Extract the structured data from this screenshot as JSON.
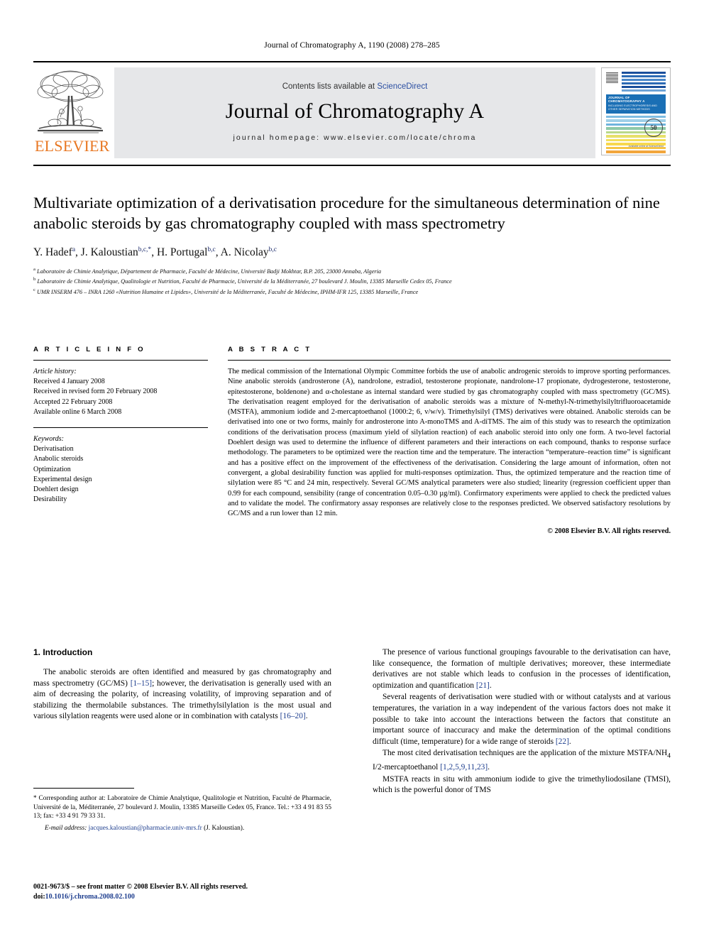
{
  "running_head": "Journal of Chromatography A, 1190 (2008) 278–285",
  "masthead": {
    "contents_prefix": "Contents lists available at ",
    "sciencedirect": "ScienceDirect",
    "journal_name": "Journal of Chromatography A",
    "homepage": "journal homepage: www.elsevier.com/locate/chroma",
    "publisher_logo_text": "ELSEVIER",
    "cover": {
      "title": "JOURNAL OF CHROMATOGRAPHY A",
      "subtitle": "INCLUDING ELECTROPHORESIS AND OTHER SEPARATION METHODS",
      "badge": "50",
      "badge_sub": "YEARS",
      "foot": "Available online at\nScienceDirect"
    }
  },
  "article": {
    "title": "Multivariate optimization of a derivatisation procedure for the simultaneous determination of nine anabolic steroids by gas chromatography coupled with mass spectrometry",
    "authors": [
      {
        "name": "Y. Hadef",
        "sup": "a"
      },
      {
        "name": "J. Kaloustian",
        "sup": "b,c,*"
      },
      {
        "name": "H. Portugal",
        "sup": "b,c"
      },
      {
        "name": "A. Nicolay",
        "sup": "b,c"
      }
    ],
    "affiliations": [
      {
        "mark": "a",
        "text": "Laboratoire de Chimie Analytique, Département de Pharmacie, Faculté de Médecine, Université Badji Mokhtar, B.P. 205, 23000 Annaba, Algeria"
      },
      {
        "mark": "b",
        "text": "Laboratoire de Chimie Analytique, Qualitologie et Nutrition, Faculté de Pharmacie, Université de la Méditerranée, 27 boulevard J. Moulin, 13385 Marseille Cedex 05, France"
      },
      {
        "mark": "c",
        "text": "UMR INSERM 476 – INRA 1260 «Nutrition Humaine et Lipides», Université de la Méditerranée, Faculté de Médecine, IPHM-IFR 125, 13385 Marseille, France"
      }
    ]
  },
  "info": {
    "heading": "A R T I C L E   I N F O",
    "history_label": "Article history:",
    "history": [
      "Received 4 January 2008",
      "Received in revised form 20 February 2008",
      "Accepted 22 February 2008",
      "Available online 6 March 2008"
    ],
    "keywords_label": "Keywords:",
    "keywords": [
      "Derivatisation",
      "Anabolic steroids",
      "Optimization",
      "Experimental design",
      "Doehlert design",
      "Desirability"
    ]
  },
  "abstract": {
    "heading": "A B S T R A C T",
    "text": "The medical commission of the International Olympic Committee forbids the use of anabolic androgenic steroids to improve sporting performances. Nine anabolic steroids (androsterone (A), nandrolone, estradiol, testosterone propionate, nandrolone-17 propionate, dydrogesterone, testosterone, epitestosterone, boldenone) and α-cholestane as internal standard were studied by gas chromatography coupled with mass spectrometry (GC/MS). The derivatisation reagent employed for the derivatisation of anabolic steroids was a mixture of N-methyl-N-trimethylsilyltrifluoroacetamide (MSTFA), ammonium iodide and 2-mercaptoethanol (1000:2; 6, v/w/v). Trimethylsilyl (TMS) derivatives were obtained. Anabolic steroids can be derivatised into one or two forms, mainly for androsterone into A-monoTMS and A-diTMS. The aim of this study was to research the optimization conditions of the derivatisation process (maximum yield of silylation reaction) of each anabolic steroid into only one form. A two-level factorial Doehlert design was used to determine the influence of different parameters and their interactions on each compound, thanks to response surface methodology. The parameters to be optimized were the reaction time and the temperature. The interaction “temperature–reaction time” is significant and has a positive effect on the improvement of the effectiveness of the derivatisation. Considering the large amount of information, often not convergent, a global desirability function was applied for multi-responses optimization. Thus, the optimized temperature and the reaction time of silylation were 85 °C and 24 min, respectively. Several GC/MS analytical parameters were also studied; linearity (regression coefficient upper than 0.99 for each compound, sensibility (range of concentration 0.05–0.30 µg/ml). Confirmatory experiments were applied to check the predicted values and to validate the model. The confirmatory assay responses are relatively close to the responses predicted. We observed satisfactory resolutions by GC/MS and a run lower than 12 min.",
    "copyright": "© 2008 Elsevier B.V. All rights reserved."
  },
  "introduction": {
    "heading": "1.  Introduction",
    "left_paragraphs": [
      "The anabolic steroids are often identified and measured by gas chromatography and mass spectrometry (GC/MS) [1–15]; however, the derivatisation is generally used with an aim of decreasing the polarity, of increasing volatility, of improving separation and of stabilizing the thermolabile substances. The trimethylsilylation is the most usual and various silylation reagents were used alone or in combination with catalysts [16–20]."
    ],
    "right_paragraphs": [
      "The presence of various functional groupings favourable to the derivatisation can have, like consequence, the formation of multiple derivatives; moreover, these intermediate derivatives are not stable which leads to confusion in the processes of identification, optimization and quantification [21].",
      "Several reagents of derivatisation were studied with or without catalysts and at various temperatures, the variation in a way independent of the various factors does not make it possible to take into account the interactions between the factors that constitute an important source of inaccuracy and make the determination of the optimal conditions difficult (time, temperature) for a wide range of steroids [22].",
      "The most cited derivatisation techniques are the application of the mixture MSTFA/NH4 I/2-mercaptoethanol [1,2,5,9,11,23].",
      "MSTFA reacts in situ with ammonium iodide to give the trimethyliodosilane (TMSI), which is the powerful donor of TMS"
    ]
  },
  "footnote": {
    "text": "* Corresponding author at: Laboratoire de Chimie Analytique, Qualitologie et Nutrition, Faculté de Pharmacie, Université de la, Méditerranée, 27 boulevard J. Moulin, 13385 Marseille Cedex 05, France. Tel.: +33 4 91 83 55 13; fax: +33 4 91 79 33 31.",
    "email_label": "E-mail address:",
    "email": "jacques.kaloustian@pharmacie.univ-mrs.fr",
    "email_owner": "(J. Kaloustian)."
  },
  "imprint": {
    "line1": "0021-9673/$ – see front matter © 2008 Elsevier B.V. All rights reserved.",
    "doi_label": "doi:",
    "doi": "10.1016/j.chroma.2008.02.100"
  },
  "colors": {
    "elsevier_orange": "#E87722",
    "link_blue": "#2b4fa2",
    "ref_blue": "#1f3f8f",
    "banner_gray": "#e6e7e9",
    "cover_blue": "#1a6fb5"
  }
}
